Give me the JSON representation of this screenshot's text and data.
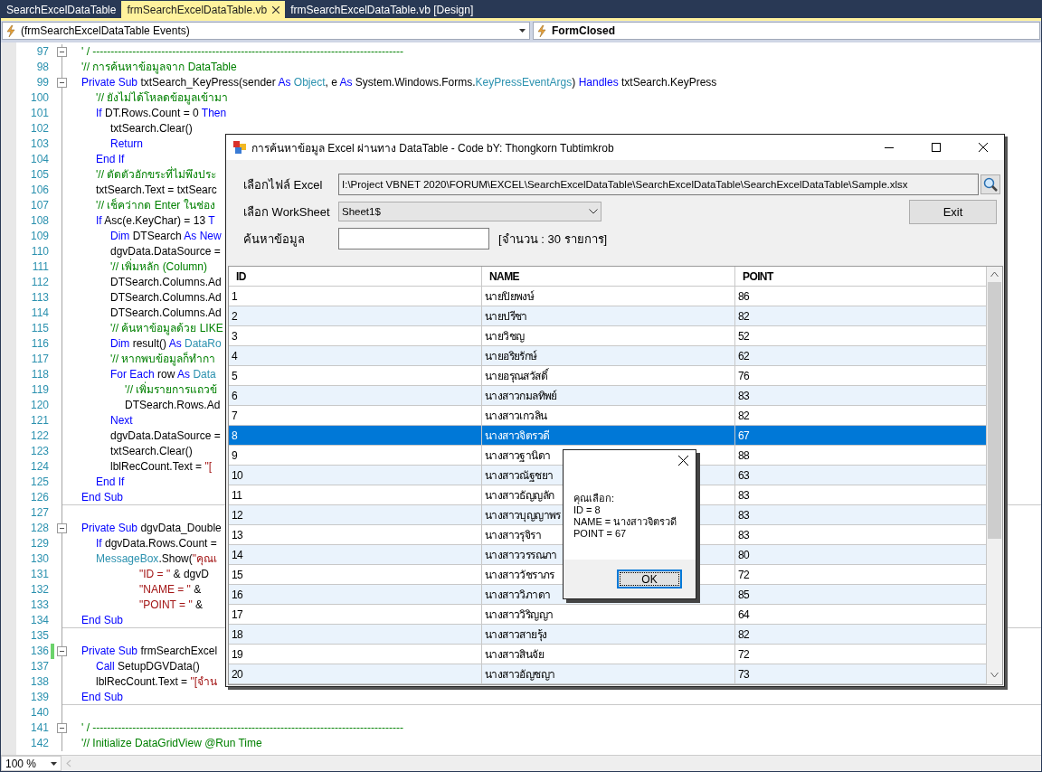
{
  "tabs": [
    {
      "label": "SearchExcelDataTable",
      "selected": false
    },
    {
      "label": "frmSearchExcelDataTable.vb",
      "selected": true
    },
    {
      "label": "frmSearchExcelDataTable.vb [Design]",
      "selected": false
    }
  ],
  "navigation": {
    "type_dropdown": "(frmSearchExcelDataTable Events)",
    "member_dropdown": "FormClosed"
  },
  "editor": {
    "lines": [
      {
        "number": "97",
        "fold": true,
        "changed": false,
        "separator_below": false,
        "segments": [
          {
            "kind": "comment",
            "text": "' / --------------------------------------------------------------------------------------"
          }
        ]
      },
      {
        "number": "98",
        "fold": false,
        "changed": false,
        "separator_below": false,
        "segments": [
          {
            "kind": "comment",
            "text": "'// การค้นหาข้อมูลจาก DataTable"
          }
        ]
      },
      {
        "number": "99",
        "fold": true,
        "changed": false,
        "separator_below": false,
        "segments": [
          {
            "kind": "keyword",
            "text": "Private Sub"
          },
          {
            "kind": "plain",
            "text": " txtSearch_KeyPress(sender "
          },
          {
            "kind": "keyword",
            "text": "As"
          },
          {
            "kind": "type",
            "text": " Object"
          },
          {
            "kind": "plain",
            "text": ", e "
          },
          {
            "kind": "keyword",
            "text": "As"
          },
          {
            "kind": "plain",
            "text": " System.Windows.Forms."
          },
          {
            "kind": "type",
            "text": "KeyPressEventArgs"
          },
          {
            "kind": "plain",
            "text": ") "
          },
          {
            "kind": "keyword",
            "text": "Handles"
          },
          {
            "kind": "plain",
            "text": " txtSearch.KeyPress"
          }
        ]
      },
      {
        "number": "100",
        "fold": false,
        "changed": false,
        "separator_below": false,
        "segments": [
          {
            "kind": "comment",
            "text": "\t'// ยังไม่ได้โหลดข้อมูลเข้ามา"
          }
        ]
      },
      {
        "number": "101",
        "fold": false,
        "changed": false,
        "separator_below": false,
        "segments": [
          {
            "kind": "keyword",
            "text": "\tIf"
          },
          {
            "kind": "plain",
            "text": " DT.Rows.Count = 0 "
          },
          {
            "kind": "keyword",
            "text": "Then"
          }
        ]
      },
      {
        "number": "102",
        "fold": false,
        "changed": false,
        "separator_below": false,
        "segments": [
          {
            "kind": "plain",
            "text": "\t\ttxtSearch.Clear()"
          }
        ]
      },
      {
        "number": "103",
        "fold": false,
        "changed": false,
        "separator_below": false,
        "segments": [
          {
            "kind": "keyword",
            "text": "\t\tReturn"
          }
        ]
      },
      {
        "number": "104",
        "fold": false,
        "changed": false,
        "separator_below": false,
        "segments": [
          {
            "kind": "keyword",
            "text": "\tEnd If"
          }
        ]
      },
      {
        "number": "105",
        "fold": false,
        "changed": false,
        "separator_below": false,
        "segments": [
          {
            "kind": "comment",
            "text": "\t'// ตัดตัวอักขระที่ไม่พึงประ"
          }
        ]
      },
      {
        "number": "106",
        "fold": false,
        "changed": false,
        "separator_below": false,
        "segments": [
          {
            "kind": "plain",
            "text": "\ttxtSearch.Text = txtSearc"
          }
        ]
      },
      {
        "number": "107",
        "fold": false,
        "changed": false,
        "separator_below": false,
        "segments": [
          {
            "kind": "comment",
            "text": "\t'// เช็คว่ากด Enter ในช่อง"
          }
        ]
      },
      {
        "number": "108",
        "fold": false,
        "changed": false,
        "separator_below": false,
        "segments": [
          {
            "kind": "keyword",
            "text": "\tIf"
          },
          {
            "kind": "plain",
            "text": " Asc(e.KeyChar) = 13 "
          },
          {
            "kind": "keyword",
            "text": "T"
          }
        ]
      },
      {
        "number": "109",
        "fold": false,
        "changed": false,
        "separator_below": false,
        "segments": [
          {
            "kind": "keyword",
            "text": "\t\tDim"
          },
          {
            "kind": "plain",
            "text": " DTSearch "
          },
          {
            "kind": "keyword",
            "text": "As New"
          }
        ]
      },
      {
        "number": "110",
        "fold": false,
        "changed": false,
        "separator_below": false,
        "segments": [
          {
            "kind": "plain",
            "text": "\t\tdgvData.DataSource ="
          }
        ]
      },
      {
        "number": "111",
        "fold": false,
        "changed": false,
        "separator_below": false,
        "segments": [
          {
            "kind": "comment",
            "text": "\t\t'// เพิ่มหลัก (Column)"
          }
        ]
      },
      {
        "number": "112",
        "fold": false,
        "changed": false,
        "separator_below": false,
        "segments": [
          {
            "kind": "plain",
            "text": "\t\tDTSearch.Columns.Ad"
          }
        ]
      },
      {
        "number": "113",
        "fold": false,
        "changed": false,
        "separator_below": false,
        "segments": [
          {
            "kind": "plain",
            "text": "\t\tDTSearch.Columns.Ad"
          }
        ]
      },
      {
        "number": "114",
        "fold": false,
        "changed": false,
        "separator_below": false,
        "segments": [
          {
            "kind": "plain",
            "text": "\t\tDTSearch.Columns.Ad"
          }
        ]
      },
      {
        "number": "115",
        "fold": false,
        "changed": false,
        "separator_below": false,
        "segments": [
          {
            "kind": "comment",
            "text": "\t\t'// ค้นหาข้อมูลด้วย LIKE"
          }
        ]
      },
      {
        "number": "116",
        "fold": false,
        "changed": false,
        "separator_below": false,
        "segments": [
          {
            "kind": "keyword",
            "text": "\t\tDim"
          },
          {
            "kind": "plain",
            "text": " result() "
          },
          {
            "kind": "keyword",
            "text": "As"
          },
          {
            "kind": "type",
            "text": " DataRo"
          }
        ]
      },
      {
        "number": "117",
        "fold": false,
        "changed": false,
        "separator_below": false,
        "segments": [
          {
            "kind": "comment",
            "text": "\t\t'// หากพบข้อมูลก็ทำกา"
          }
        ]
      },
      {
        "number": "118",
        "fold": false,
        "changed": false,
        "separator_below": false,
        "segments": [
          {
            "kind": "keyword",
            "text": "\t\tFor Each"
          },
          {
            "kind": "plain",
            "text": " row "
          },
          {
            "kind": "keyword",
            "text": "As"
          },
          {
            "kind": "type",
            "text": " Data"
          }
        ]
      },
      {
        "number": "119",
        "fold": false,
        "changed": false,
        "separator_below": false,
        "segments": [
          {
            "kind": "comment",
            "text": "\t\t\t'// เพิ่มรายการแถวข้"
          }
        ]
      },
      {
        "number": "120",
        "fold": false,
        "changed": false,
        "separator_below": false,
        "segments": [
          {
            "kind": "plain",
            "text": "\t\t\tDTSearch.Rows.Ad"
          }
        ]
      },
      {
        "number": "121",
        "fold": false,
        "changed": false,
        "separator_below": false,
        "segments": [
          {
            "kind": "keyword",
            "text": "\t\tNext"
          }
        ]
      },
      {
        "number": "122",
        "fold": false,
        "changed": false,
        "separator_below": false,
        "segments": [
          {
            "kind": "plain",
            "text": "\t\tdgvData.DataSource ="
          }
        ]
      },
      {
        "number": "123",
        "fold": false,
        "changed": false,
        "separator_below": false,
        "segments": [
          {
            "kind": "plain",
            "text": "\t\ttxtSearch.Clear()"
          }
        ]
      },
      {
        "number": "124",
        "fold": false,
        "changed": false,
        "separator_below": false,
        "segments": [
          {
            "kind": "plain",
            "text": "\t\tlblRecCount.Text = "
          },
          {
            "kind": "string",
            "text": "\"["
          }
        ]
      },
      {
        "number": "125",
        "fold": false,
        "changed": false,
        "separator_below": false,
        "segments": [
          {
            "kind": "keyword",
            "text": "\tEnd If"
          }
        ]
      },
      {
        "number": "126",
        "fold": false,
        "changed": false,
        "separator_below": true,
        "segments": [
          {
            "kind": "keyword",
            "text": "End Sub"
          }
        ]
      },
      {
        "number": "127",
        "fold": false,
        "changed": false,
        "separator_below": false
      },
      {
        "number": "128",
        "fold": true,
        "changed": false,
        "separator_below": false,
        "segments": [
          {
            "kind": "keyword",
            "text": "Private Sub"
          },
          {
            "kind": "plain",
            "text": " dgvData_Double"
          }
        ]
      },
      {
        "number": "129",
        "fold": false,
        "changed": false,
        "separator_below": false,
        "segments": [
          {
            "kind": "keyword",
            "text": "\tIf"
          },
          {
            "kind": "plain",
            "text": " dgvData.Rows.Count ="
          }
        ]
      },
      {
        "number": "130",
        "fold": false,
        "changed": false,
        "separator_below": false,
        "segments": [
          {
            "kind": "type",
            "text": "\tMessageBox"
          },
          {
            "kind": "plain",
            "text": ".Show("
          },
          {
            "kind": "string",
            "text": "\"คุณเ"
          }
        ]
      },
      {
        "number": "131",
        "fold": false,
        "changed": false,
        "separator_below": false,
        "segments": [
          {
            "kind": "string",
            "text": "\t\t\t\t\"ID = \""
          },
          {
            "kind": "plain",
            "text": " & dgvD"
          }
        ]
      },
      {
        "number": "132",
        "fold": false,
        "changed": false,
        "separator_below": false,
        "segments": [
          {
            "kind": "string",
            "text": "\t\t\t\t\"NAME = \""
          },
          {
            "kind": "plain",
            "text": " &"
          }
        ]
      },
      {
        "number": "133",
        "fold": false,
        "changed": false,
        "separator_below": false,
        "segments": [
          {
            "kind": "string",
            "text": "\t\t\t\t\"POINT = \""
          },
          {
            "kind": "plain",
            "text": " &"
          }
        ]
      },
      {
        "number": "134",
        "fold": false,
        "changed": false,
        "separator_below": true,
        "segments": [
          {
            "kind": "keyword",
            "text": "End Sub"
          }
        ]
      },
      {
        "number": "135",
        "fold": false,
        "changed": false,
        "separator_below": false
      },
      {
        "number": "136",
        "fold": true,
        "changed": true,
        "separator_below": false,
        "segments": [
          {
            "kind": "keyword",
            "text": "Private Sub"
          },
          {
            "kind": "plain",
            "text": " frmSearchExcel"
          }
        ]
      },
      {
        "number": "137",
        "fold": false,
        "changed": false,
        "separator_below": false,
        "segments": [
          {
            "kind": "keyword",
            "text": "\tCall"
          },
          {
            "kind": "plain",
            "text": " SetupDGVData()"
          }
        ]
      },
      {
        "number": "138",
        "fold": false,
        "changed": false,
        "separator_below": false,
        "segments": [
          {
            "kind": "plain",
            "text": "\tlblRecCount.Text = "
          },
          {
            "kind": "string",
            "text": "\"[จำน"
          }
        ]
      },
      {
        "number": "139",
        "fold": false,
        "changed": false,
        "separator_below": true,
        "segments": [
          {
            "kind": "keyword",
            "text": "End Sub"
          }
        ]
      },
      {
        "number": "140",
        "fold": false,
        "changed": false,
        "separator_below": false
      },
      {
        "number": "141",
        "fold": true,
        "changed": false,
        "separator_below": false,
        "segments": [
          {
            "kind": "comment",
            "text": "' / --------------------------------------------------------------------------------------"
          }
        ]
      },
      {
        "number": "142",
        "fold": false,
        "changed": false,
        "separator_below": false,
        "segments": [
          {
            "kind": "comment",
            "text": "'// Initialize DataGridView @Run Time"
          }
        ]
      }
    ]
  },
  "form": {
    "title": "การค้นหาข้อมูล Excel ผ่านทาง DataTable  - Code bY: Thongkorn Tubtimkrob",
    "file_label": "เลือกไฟล์ Excel",
    "file_path": "I:\\Project VBNET 2020\\FORUM\\EXCEL\\SearchExcelDataTable\\SearchExcelDataTable\\SearchExcelDataTable\\Sample.xlsx",
    "sheet_label": "เลือก WorkSheet",
    "sheet": "Sheet1$",
    "exit_button": "Exit",
    "search_label": "ค้นหาข้อมูล",
    "record_count": "[จำนวน : 30 รายการ]",
    "table": {
      "columns": [
        "ID",
        "NAME",
        "POINT"
      ],
      "rows": [
        {
          "cells": [
            "1",
            "นายปิยพงษ์",
            "86"
          ],
          "selected": false
        },
        {
          "cells": [
            "2",
            "นายปรีชา",
            "82"
          ],
          "selected": false
        },
        {
          "cells": [
            "3",
            "นายวิชญ",
            "52"
          ],
          "selected": false
        },
        {
          "cells": [
            "4",
            "นายอริยรักษ์",
            "62"
          ],
          "selected": false
        },
        {
          "cells": [
            "5",
            "นายอรุณสวัสดิ์",
            "76"
          ],
          "selected": false
        },
        {
          "cells": [
            "6",
            "นางสาวกมลทิพย์",
            "83"
          ],
          "selected": false
        },
        {
          "cells": [
            "7",
            "นางสาวเกวลิน",
            "82"
          ],
          "selected": false
        },
        {
          "cells": [
            "8",
            "นางสาวจิตรวดี",
            "67"
          ],
          "selected": true
        },
        {
          "cells": [
            "9",
            "นางสาวฐานิดา",
            "88"
          ],
          "selected": false
        },
        {
          "cells": [
            "10",
            "นางสาวณัฐชยา",
            "63"
          ],
          "selected": false
        },
        {
          "cells": [
            "11",
            "นางสาวธัญญลัก",
            "83"
          ],
          "selected": false
        },
        {
          "cells": [
            "12",
            "นางสาวบุญญาพร",
            "83"
          ],
          "selected": false
        },
        {
          "cells": [
            "13",
            "นางสาวรุจิรา",
            "83"
          ],
          "selected": false
        },
        {
          "cells": [
            "14",
            "นางสาววรรณภา",
            "80"
          ],
          "selected": false
        },
        {
          "cells": [
            "15",
            "นางสาววัชราภร",
            "72"
          ],
          "selected": false
        },
        {
          "cells": [
            "16",
            "นางสาววิภาดา",
            "85"
          ],
          "selected": false
        },
        {
          "cells": [
            "17",
            "นางสาววิริญญา",
            "64"
          ],
          "selected": false
        },
        {
          "cells": [
            "18",
            "นางสาวสายรุ้ง",
            "82"
          ],
          "selected": false
        },
        {
          "cells": [
            "19",
            "นางสาวสินจัย",
            "72"
          ],
          "selected": false
        },
        {
          "cells": [
            "20",
            "นางสาวอัญชญา",
            "73"
          ],
          "selected": false
        }
      ]
    }
  },
  "message_box": {
    "lines": [
      "คุณเลือก:",
      "ID = 8",
      "NAME = นางสาวจิตรวดี",
      "POINT = 67"
    ],
    "ok_button": "OK"
  },
  "status_bar": {
    "zoom": "100 %"
  }
}
